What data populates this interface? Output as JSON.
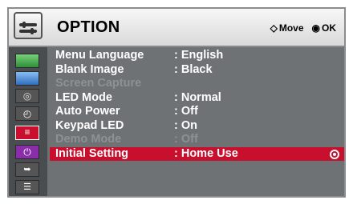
{
  "menu": {
    "title": "OPTION",
    "hints": [
      {
        "glyph": "◇",
        "label": "Move"
      },
      {
        "glyph": "◉",
        "label": "OK"
      }
    ]
  },
  "sidebar": [
    {
      "icon": "picture-icon",
      "color": "#3aa845"
    },
    {
      "icon": "screen-icon",
      "color": "#3b7fd4"
    },
    {
      "icon": "timer-icon",
      "color": "#6a6a6a"
    },
    {
      "icon": "clock-icon",
      "color": "#7a7a7a"
    },
    {
      "icon": "option-icon",
      "color": "#c8102e",
      "active": true
    },
    {
      "icon": "power-icon",
      "color": "#8a2da8"
    },
    {
      "icon": "input-icon",
      "color": "#5a5a5a"
    },
    {
      "icon": "info-icon",
      "color": "#5a5a5a"
    }
  ],
  "rows": [
    {
      "label": "Menu Language",
      "value": ": English",
      "state": "normal"
    },
    {
      "label": "Blank Image",
      "value": ": Black",
      "state": "normal"
    },
    {
      "label": "Screen Capture",
      "value": "",
      "state": "disabled"
    },
    {
      "label": "LED Mode",
      "value": ": Normal",
      "state": "normal"
    },
    {
      "label": "Auto Power",
      "value": ": Off",
      "state": "normal"
    },
    {
      "label": "Keypad LED",
      "value": ": On",
      "state": "normal"
    },
    {
      "label": "Demo Mode",
      "value": ": Off",
      "state": "disabled"
    },
    {
      "label": "Initial Setting",
      "value": ": Home Use",
      "state": "selected"
    }
  ]
}
